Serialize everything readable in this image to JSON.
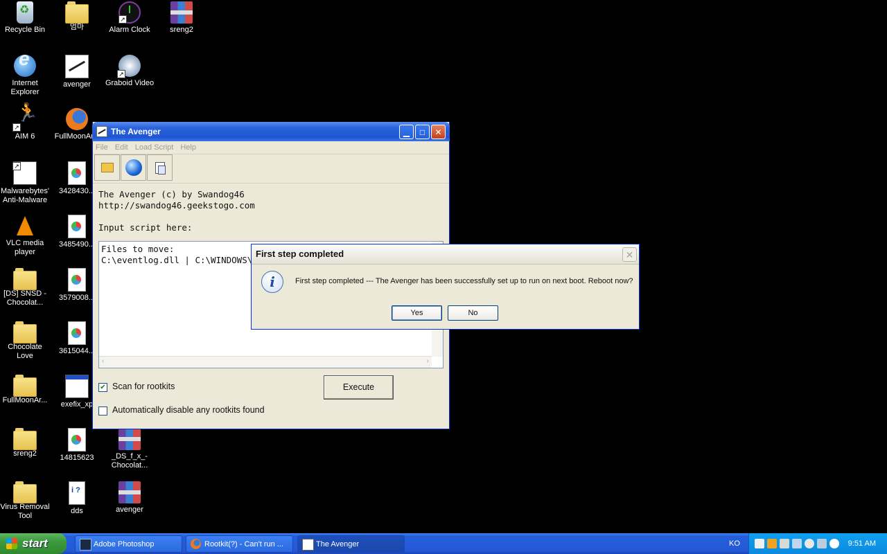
{
  "desktop": {
    "icons": [
      {
        "label": "Recycle Bin",
        "icon": "recycle-bin-icon"
      },
      {
        "label": "엄마",
        "icon": "folder-icon"
      },
      {
        "label": "Alarm Clock",
        "icon": "alarm-clock-icon"
      },
      {
        "label": "sreng2",
        "icon": "rar-archive-icon"
      },
      {
        "label": "Internet\nExplorer",
        "icon": "internet-explorer-icon"
      },
      {
        "label": "avenger",
        "icon": "avenger-sword-icon"
      },
      {
        "label": "Graboid Video",
        "icon": "graboid-video-icon"
      },
      {
        "label": "AIM 6",
        "icon": "aim-icon"
      },
      {
        "label": "FullMoonAr...",
        "icon": "firefox-document-icon"
      },
      {
        "label": "Malwarebytes'\nAnti-Malware",
        "icon": "malwarebytes-icon"
      },
      {
        "label": "3428430...",
        "icon": "image-document-icon"
      },
      {
        "label": "VLC media\nplayer",
        "icon": "vlc-icon"
      },
      {
        "label": "3485490...",
        "icon": "image-document-icon"
      },
      {
        "label": "[DS] SNSD -\nChocolat...",
        "icon": "folder-icon"
      },
      {
        "label": "3579008...",
        "icon": "image-document-icon"
      },
      {
        "label": "Chocolate\nLove",
        "icon": "folder-icon"
      },
      {
        "label": "3615044...",
        "icon": "image-document-icon"
      },
      {
        "label": "FullMoonAr...",
        "icon": "folder-icon"
      },
      {
        "label": "exefix_xp",
        "icon": "program-window-icon"
      },
      {
        "label": "sreng2",
        "icon": "folder-icon"
      },
      {
        "label": "14815623",
        "icon": "image-document-icon"
      },
      {
        "label": "_DS_f_x_-\nChocolat...",
        "icon": "rar-archive-icon"
      },
      {
        "label": "Virus Removal\nTool",
        "icon": "folder-icon"
      },
      {
        "label": "dds",
        "icon": "dds-script-icon"
      },
      {
        "label": "avenger",
        "icon": "rar-archive-icon"
      }
    ]
  },
  "avenger_window": {
    "title": "The Avenger",
    "menu": [
      "File",
      "Edit",
      "Load Script",
      "Help"
    ],
    "toolbar": [
      "open-icon",
      "globe-icon",
      "paste-icon"
    ],
    "credit_line1": "The Avenger (c) by Swandog46",
    "credit_line2": "http://swandog46.geekstogo.com",
    "input_label": "Input script here:",
    "script_text": "Files to move:\nC:\\eventlog.dll | C:\\WINDOWS\\s",
    "scan_rootkits_label": "Scan for rootkits",
    "scan_rootkits_checked": true,
    "auto_disable_label": "Automatically disable any rootkits found",
    "auto_disable_checked": false,
    "execute_label": "Execute"
  },
  "dialog": {
    "title": "First step completed",
    "message": "First step completed --- The Avenger has been successfully set up to run on next boot.  Reboot now?",
    "yes_label": "Yes",
    "no_label": "No"
  },
  "taskbar": {
    "start_label": "start",
    "tasks": [
      {
        "label": "Adobe Photoshop",
        "icon": "photoshop-icon"
      },
      {
        "label": "Rootkit(?) - Can't run ...",
        "icon": "firefox-icon"
      },
      {
        "label": "The Avenger",
        "icon": "avenger-icon"
      }
    ],
    "language": "KO",
    "clock": "9:51 AM"
  }
}
